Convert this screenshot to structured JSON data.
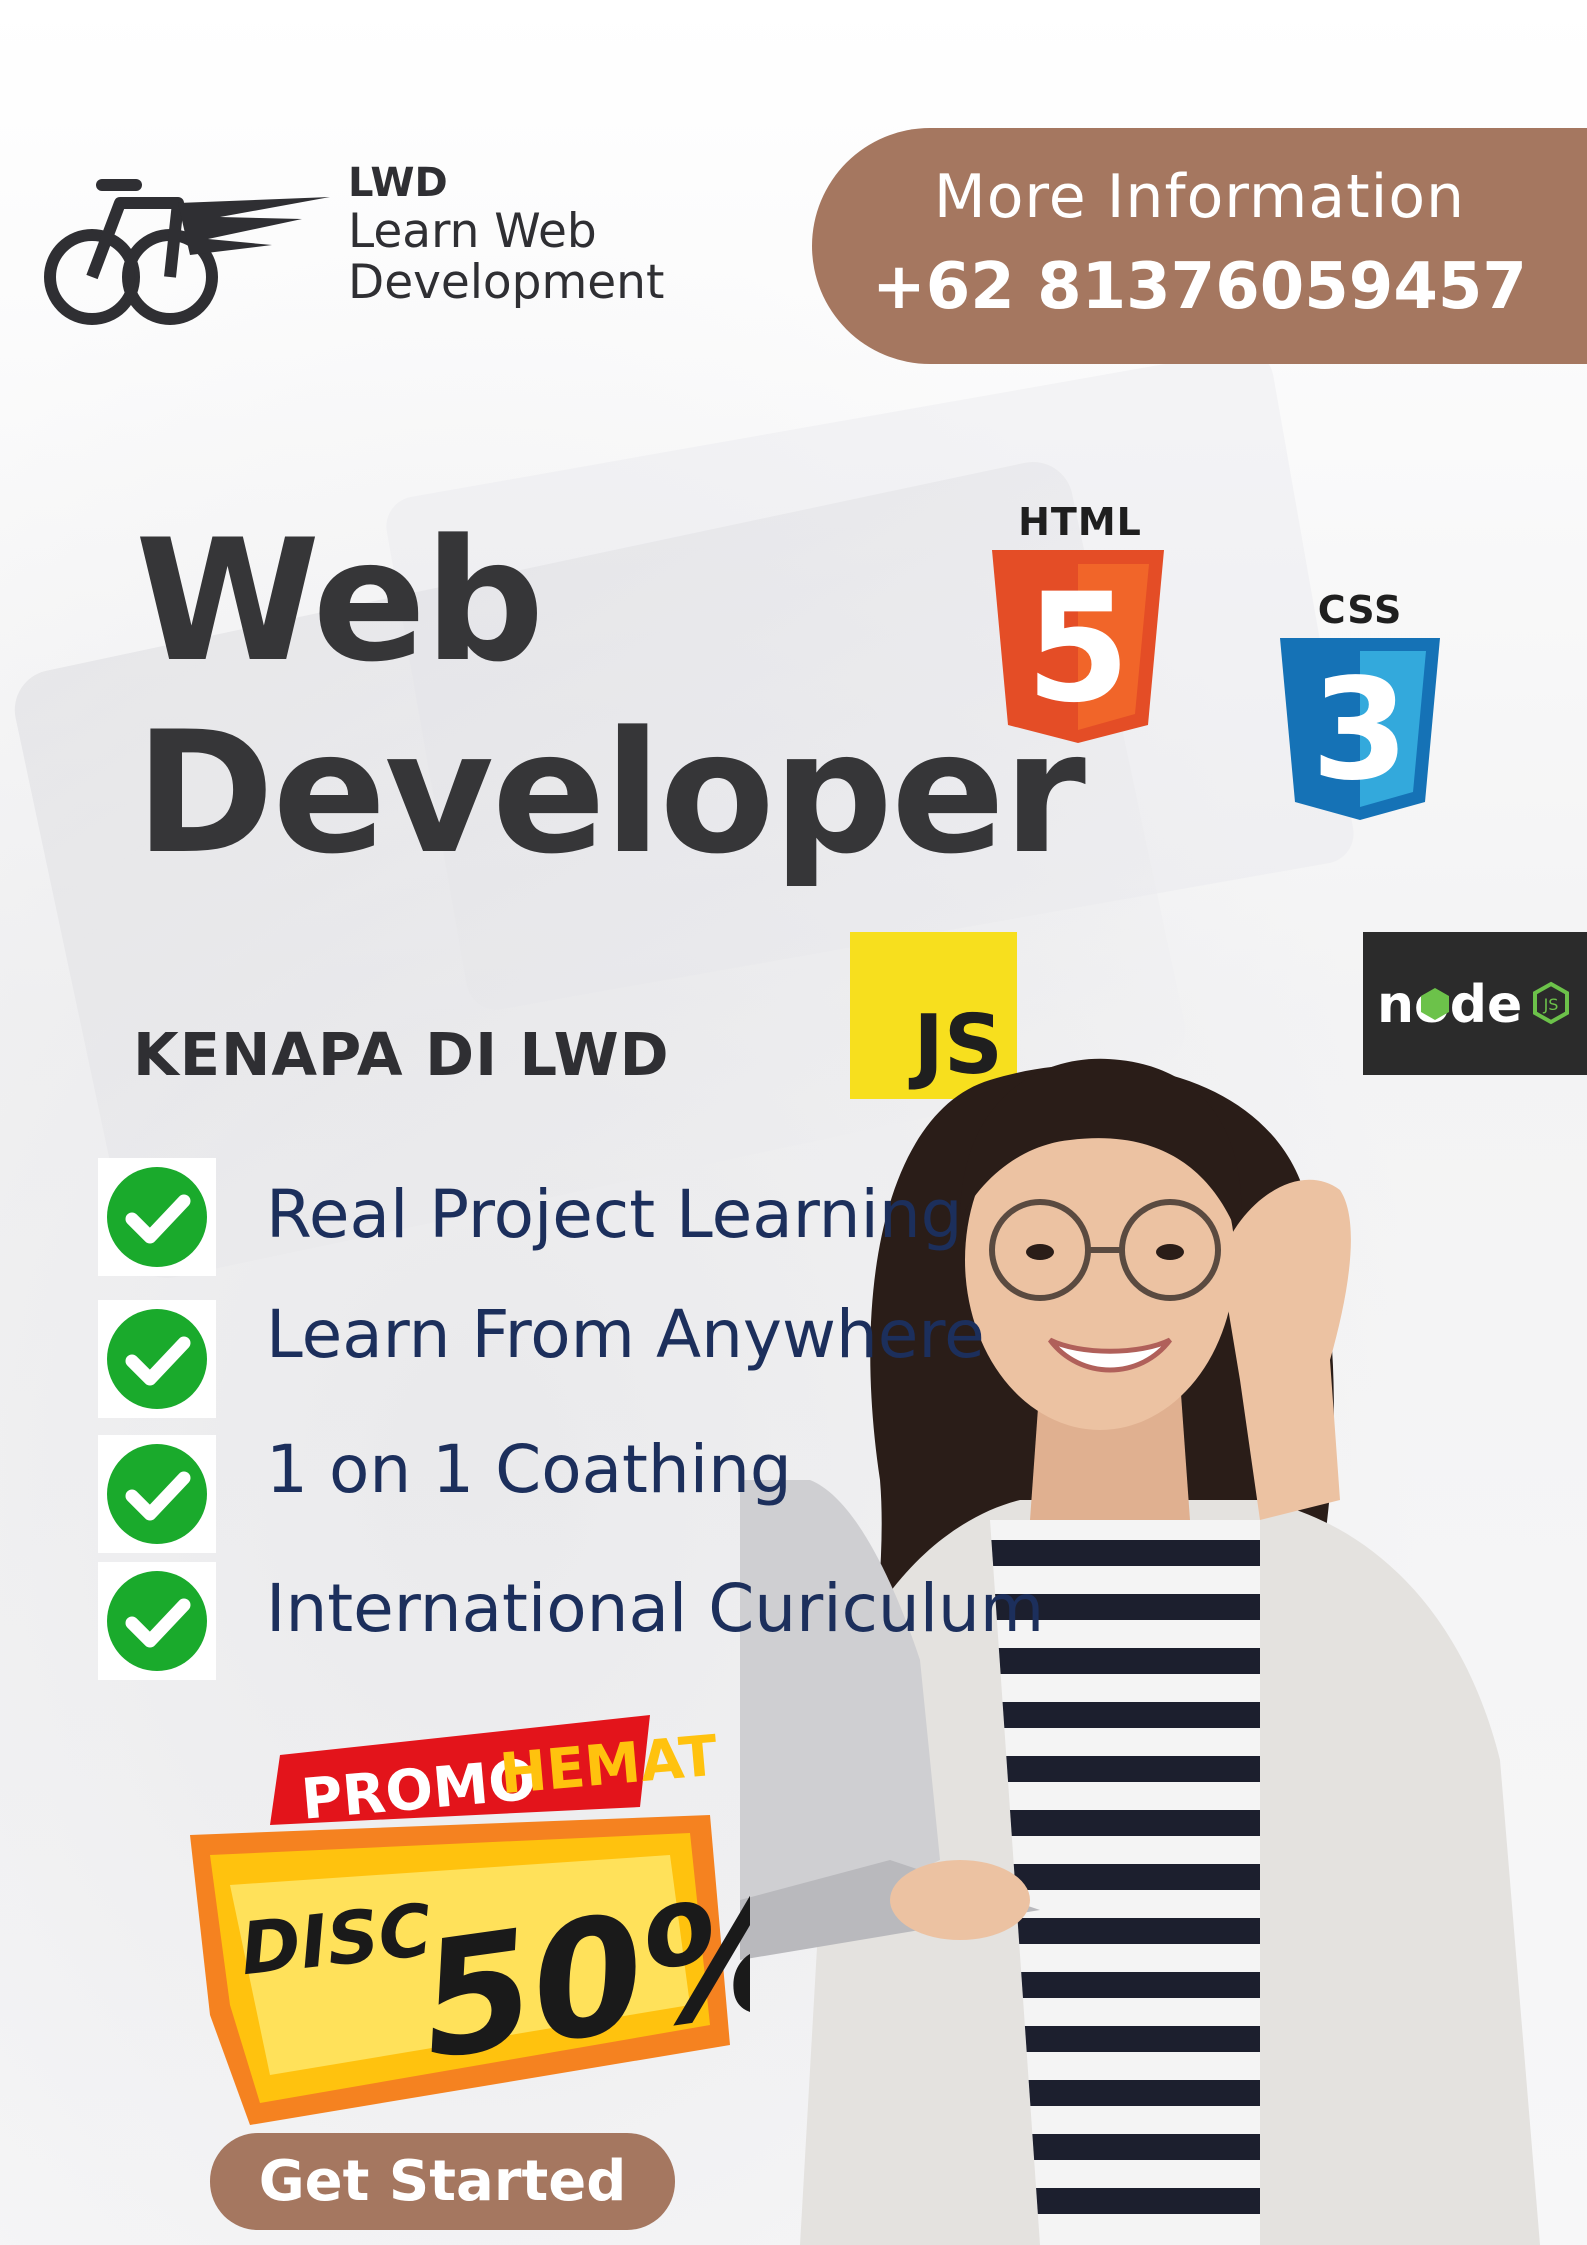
{
  "brand": {
    "abbr": "LWD",
    "line1": "Learn Web",
    "line2": "Development"
  },
  "info": {
    "title": "More Information",
    "phone": "+62 81376059457"
  },
  "headline": {
    "line1": "Web",
    "line2": "Developer"
  },
  "tech": {
    "html_label": "HTML",
    "html_number": "5",
    "css_label": "CSS",
    "css_number": "3",
    "js_label": "JS",
    "node_label": "node",
    "node_badge": "JS"
  },
  "section_title": "KENAPA DI LWD",
  "benefits": [
    "Real Project Learning",
    "Learn From Anywhere",
    "1 on 1 Coathing",
    "International Curiculum"
  ],
  "promo": {
    "word1": "PROMO",
    "word2": "HEMAT",
    "disc": "DISC",
    "percent": "50%"
  },
  "cta_label": "Get Started",
  "colors": {
    "brown_accent": "#a57760",
    "headline": "#363638",
    "benefit_text": "#1c2f5c",
    "check_green": "#1aaa2c",
    "html_orange": "#e44d26",
    "css_blue": "#1572b6",
    "js_yellow": "#f7df1e",
    "node_green": "#6cc24a",
    "promo_red": "#e3141b",
    "promo_yellow": "#ffc20e"
  }
}
